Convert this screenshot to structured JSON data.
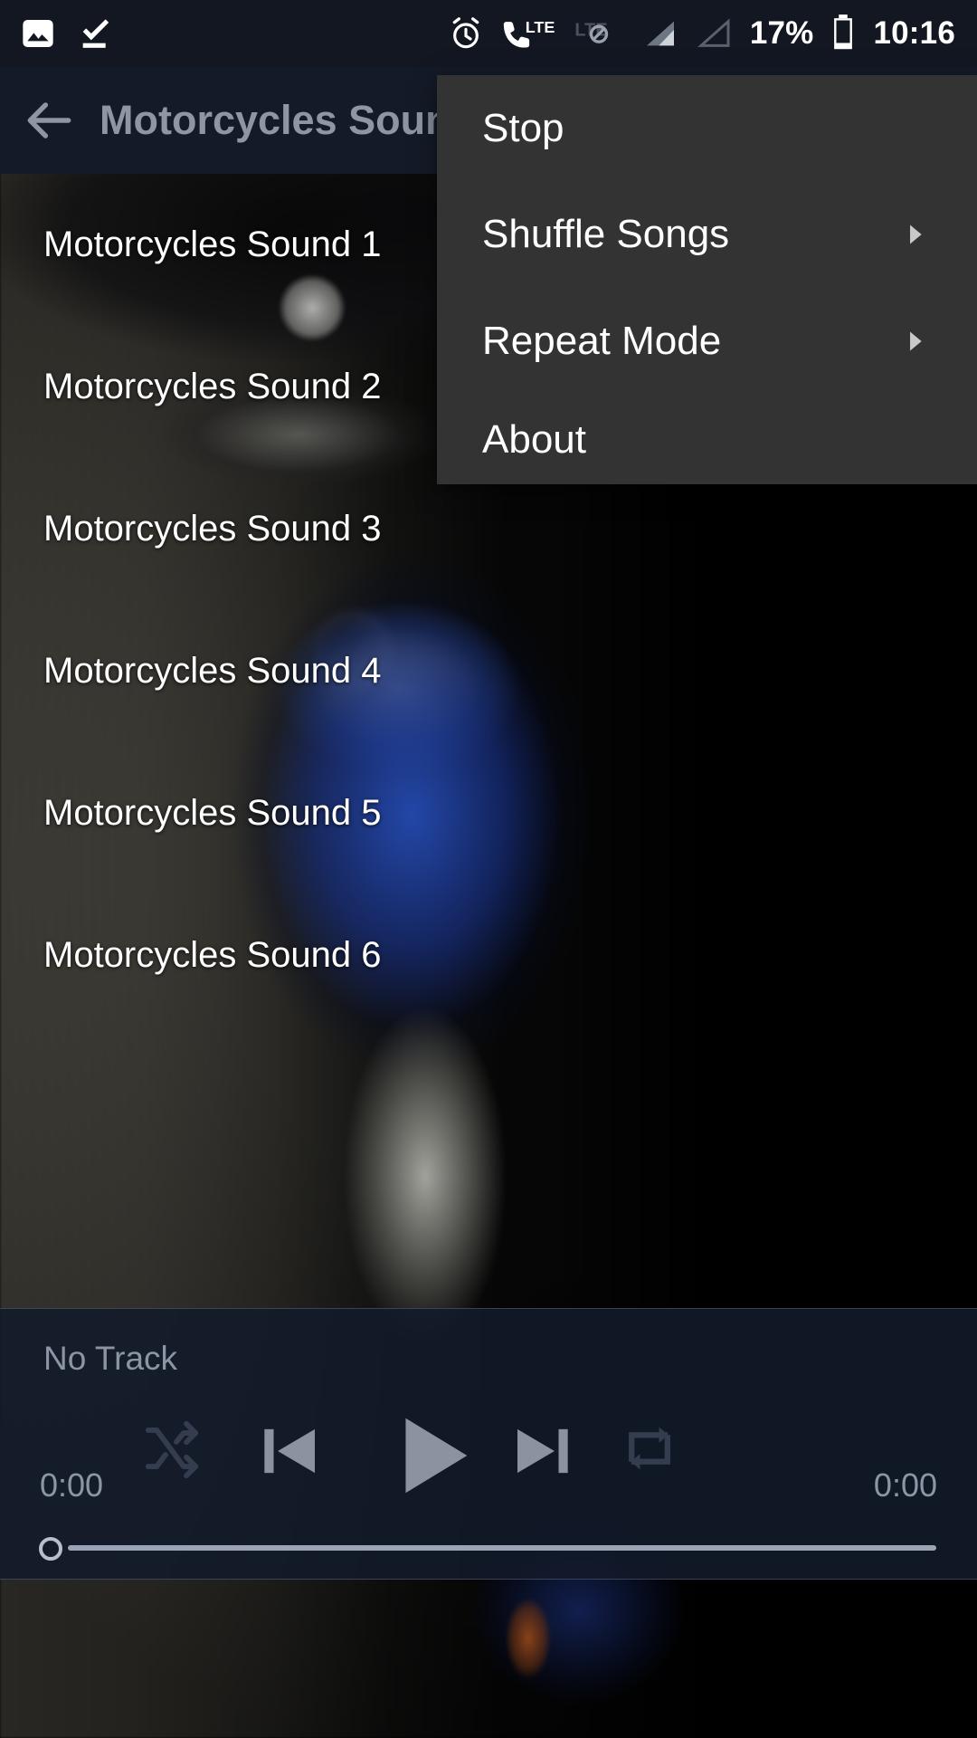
{
  "status_bar": {
    "left_icons": [
      {
        "name": "screenshot-image-icon",
        "label": "Screenshot"
      },
      {
        "name": "download-complete-icon",
        "label": "Download complete"
      }
    ],
    "right_icons": [
      {
        "name": "alarm-clock-icon",
        "label": "Alarm set"
      },
      {
        "name": "lte-call-icon",
        "label": "LTE"
      },
      {
        "name": "lte-disabled-icon",
        "label": "LTE"
      },
      {
        "name": "signal-bars-filled-icon",
        "label": "Signal"
      },
      {
        "name": "signal-bars-empty-icon",
        "label": "Signal"
      }
    ],
    "battery_percent": "17%",
    "battery_icon": "battery-low-icon",
    "time": "10:16"
  },
  "app_bar": {
    "back_icon": "arrow-left-icon",
    "title": "Motorcycles Sound",
    "title_visible": "Motorcycl"
  },
  "song_list": {
    "items": [
      {
        "title": "Motorcycles Sound 1"
      },
      {
        "title": "Motorcycles Sound 2"
      },
      {
        "title": "Motorcycles Sound 3"
      },
      {
        "title": "Motorcycles Sound 4"
      },
      {
        "title": "Motorcycles Sound 5"
      },
      {
        "title": "Motorcycles Sound 6"
      }
    ]
  },
  "player": {
    "track_title": "No Track",
    "current_time": "0:00",
    "total_time": "0:00",
    "progress_percent": 0,
    "controls": [
      {
        "name": "shuffle-icon",
        "label": "Shuffle",
        "enabled": false
      },
      {
        "name": "previous-track-icon",
        "label": "Previous"
      },
      {
        "name": "play-icon",
        "label": "Play"
      },
      {
        "name": "next-track-icon",
        "label": "Next"
      },
      {
        "name": "repeat-icon",
        "label": "Repeat",
        "enabled": false
      }
    ]
  },
  "menu": {
    "items": [
      {
        "label": "Stop",
        "has_submenu": false
      },
      {
        "label": "Shuffle Songs",
        "has_submenu": true
      },
      {
        "label": "Repeat Mode",
        "has_submenu": true
      },
      {
        "label": "About",
        "has_submenu": false
      }
    ],
    "background_color": "#333333"
  },
  "colors": {
    "status_bar_bg": "#131722",
    "app_bar_bg": "#141b28",
    "player_bar_bg": "#121a2a",
    "accent_text": "#ffffff",
    "muted_text": "#8b95a4"
  }
}
